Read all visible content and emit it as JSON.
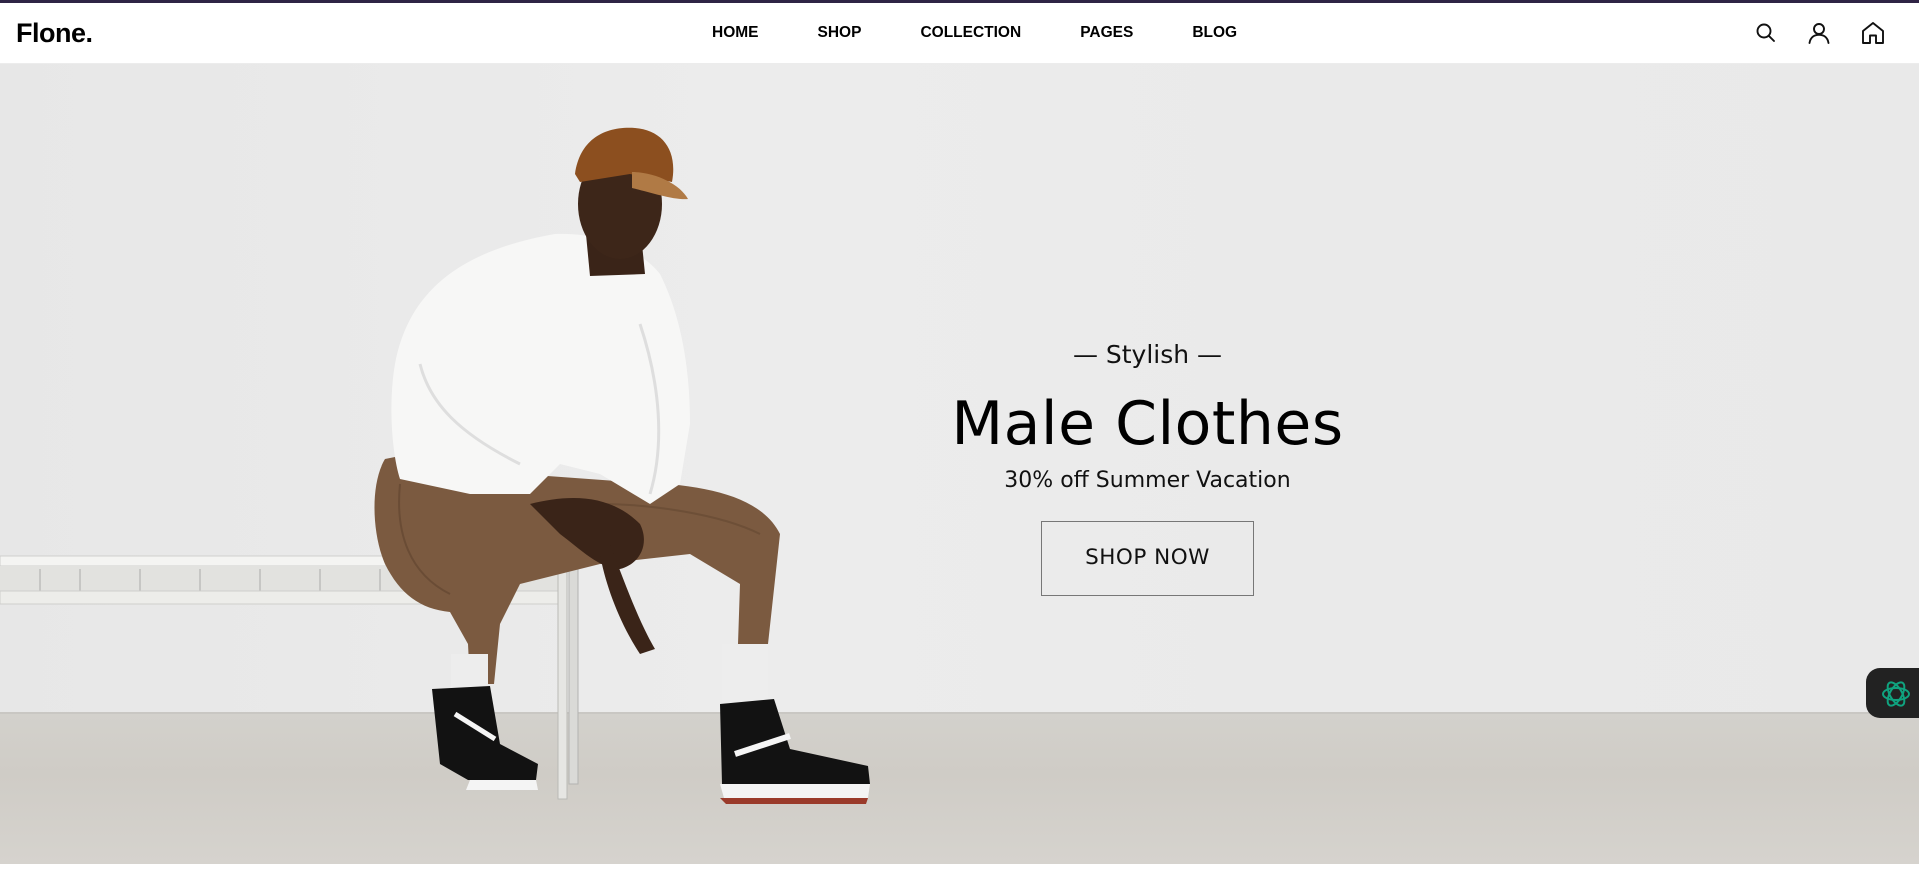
{
  "brand": {
    "logo_text": "Flone."
  },
  "nav": {
    "items": [
      {
        "label": "HOME"
      },
      {
        "label": "SHOP"
      },
      {
        "label": "COLLECTION"
      },
      {
        "label": "PAGES"
      },
      {
        "label": "BLOG"
      }
    ]
  },
  "header_icons": [
    "search-icon",
    "user-icon",
    "home-icon"
  ],
  "hero": {
    "kicker": "— Stylish —",
    "headline": "Male Clothes",
    "subheading": "30% off Summer Vacation",
    "cta_label": "SHOP NOW"
  },
  "colors": {
    "top_accent": "#2f2445",
    "widget_background": "#222222",
    "widget_icon": "#10a37f"
  }
}
